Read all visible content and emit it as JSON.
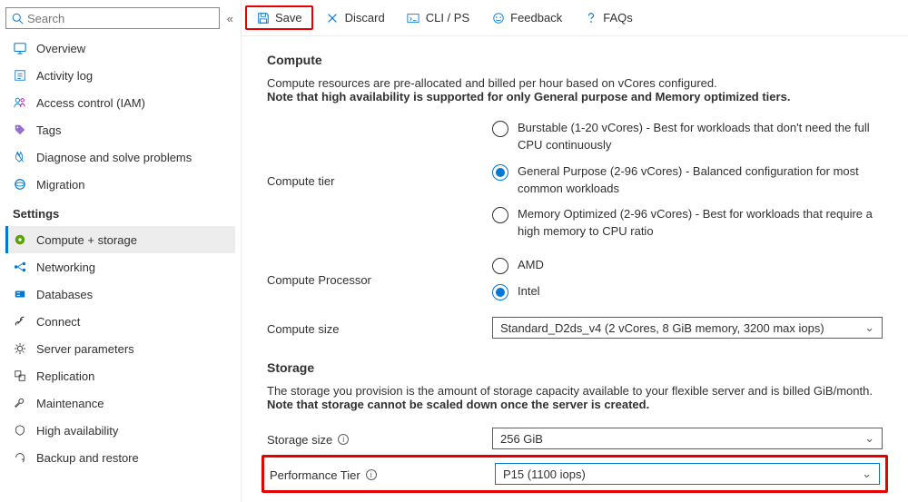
{
  "search": {
    "placeholder": "Search"
  },
  "nav": {
    "top": [
      {
        "label": "Overview"
      },
      {
        "label": "Activity log"
      },
      {
        "label": "Access control (IAM)"
      },
      {
        "label": "Tags"
      },
      {
        "label": "Diagnose and solve problems"
      },
      {
        "label": "Migration"
      }
    ],
    "settings_header": "Settings",
    "settings": [
      {
        "label": "Compute + storage"
      },
      {
        "label": "Networking"
      },
      {
        "label": "Databases"
      },
      {
        "label": "Connect"
      },
      {
        "label": "Server parameters"
      },
      {
        "label": "Replication"
      },
      {
        "label": "Maintenance"
      },
      {
        "label": "High availability"
      },
      {
        "label": "Backup and restore"
      }
    ]
  },
  "toolbar": {
    "save": "Save",
    "discard": "Discard",
    "cli": "CLI / PS",
    "feedback": "Feedback",
    "faqs": "FAQs"
  },
  "compute": {
    "heading": "Compute",
    "desc_plain": "Compute resources are pre-allocated and billed per hour based on vCores configured.",
    "desc_bold": "Note that high availability is supported for only General purpose and Memory optimized tiers.",
    "tier_label": "Compute tier",
    "tiers": [
      "Burstable (1-20 vCores) - Best for workloads that don't need the full CPU continuously",
      "General Purpose (2-96 vCores) - Balanced configuration for most common workloads",
      "Memory Optimized (2-96 vCores) - Best for workloads that require a high memory to CPU ratio"
    ],
    "processor_label": "Compute Processor",
    "processors": [
      "AMD",
      "Intel"
    ],
    "size_label": "Compute size",
    "size_value": "Standard_D2ds_v4 (2 vCores, 8 GiB memory, 3200 max iops)"
  },
  "storage": {
    "heading": "Storage",
    "desc_plain": "The storage you provision is the amount of storage capacity available to your flexible server and is billed GiB/month.",
    "desc_bold": "Note that storage cannot be scaled down once the server is created.",
    "size_label": "Storage size",
    "size_value": "256 GiB",
    "perf_label": "Performance Tier",
    "perf_value": "P15 (1100 iops)"
  }
}
